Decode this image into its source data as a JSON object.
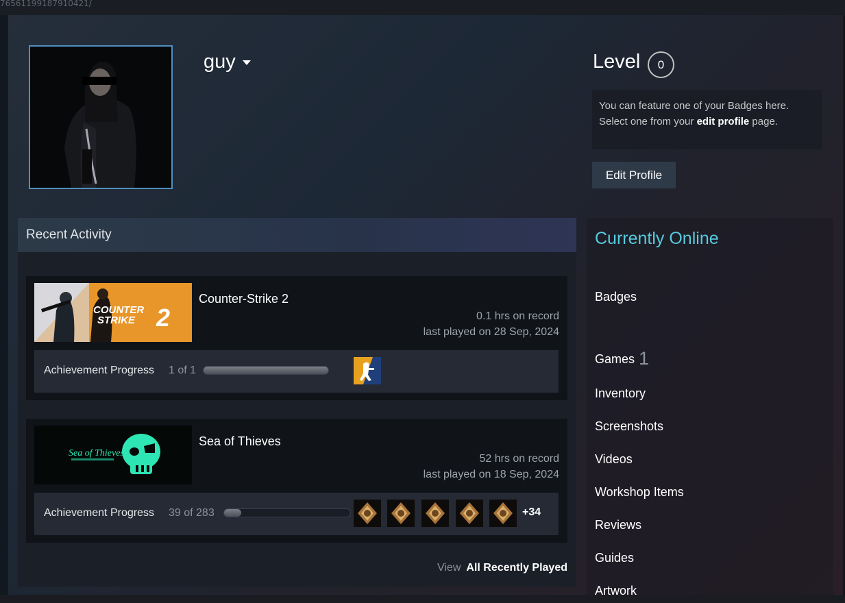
{
  "url": "76561199187910421/",
  "profile": {
    "username": "guy",
    "level_label": "Level",
    "level_value": "0",
    "badge_text_1": "You can feature one of your Badges here.",
    "badge_text_2_pre": "Select one from your ",
    "badge_text_2_link": "edit profile",
    "badge_text_2_post": " page.",
    "edit_button": "Edit Profile"
  },
  "recent": {
    "title": "Recent Activity",
    "games": [
      {
        "name": "Counter-Strike 2",
        "hours": "0.1 hrs on record",
        "last_played": "last played on 28 Sep, 2024",
        "ach_label": "Achievement Progress",
        "ach_count": "1 of 1",
        "ach_progress": 1.0
      },
      {
        "name": "Sea of Thieves",
        "hours": "52 hrs on record",
        "last_played": "last played on 18 Sep, 2024",
        "ach_label": "Achievement Progress",
        "ach_count": "39 of 283",
        "ach_progress": 0.138,
        "more": "+34"
      }
    ],
    "view_label": "View",
    "view_link": "All Recently Played"
  },
  "sidebar": {
    "status": "Currently Online",
    "badges": "Badges",
    "games": "Games",
    "games_count": "1",
    "inventory": "Inventory",
    "screenshots": "Screenshots",
    "videos": "Videos",
    "workshop": "Workshop Items",
    "reviews": "Reviews",
    "guides": "Guides",
    "artwork": "Artwork"
  },
  "colors": {
    "accent_online": "#57cbde",
    "avatar_border": "#4f8fbf",
    "cs2_orange": "#e8962a",
    "sot_green": "#2ee6b4"
  }
}
